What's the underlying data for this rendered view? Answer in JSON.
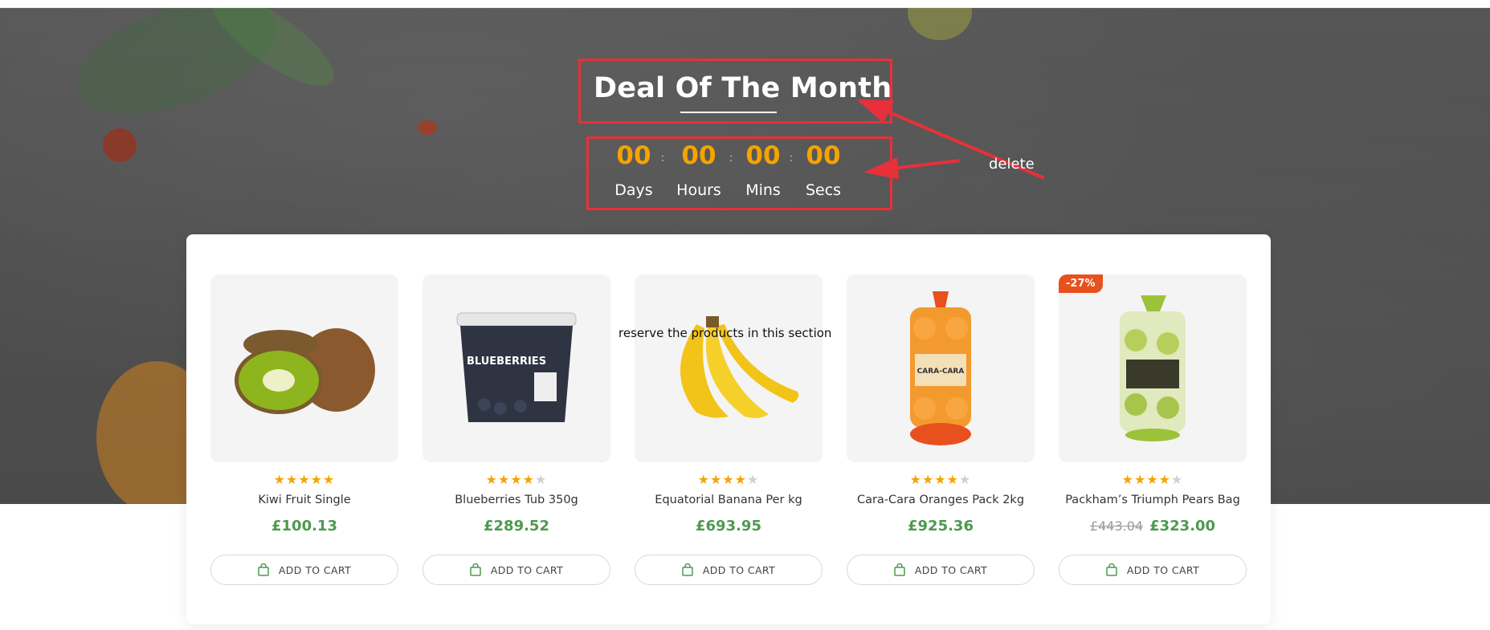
{
  "deal": {
    "title": "Deal Of The Month",
    "countdown": [
      {
        "value": "00",
        "label": "Days"
      },
      {
        "value": "00",
        "label": "Hours"
      },
      {
        "value": "00",
        "label": "Mins"
      },
      {
        "value": "00",
        "label": "Secs"
      }
    ],
    "separator": ":"
  },
  "annotations": {
    "delete_label": "delete",
    "reserve_label": "reserve  the products in this section",
    "color": "#e8303a"
  },
  "products": [
    {
      "name": "Kiwi Fruit Single",
      "price": "£100.13",
      "old_price": "",
      "badge": "",
      "rating": 5,
      "add_to_cart": "ADD TO CART"
    },
    {
      "name": "Blueberries Tub 350g",
      "price": "£289.52",
      "old_price": "",
      "badge": "",
      "rating": 4,
      "add_to_cart": "ADD TO CART"
    },
    {
      "name": "Equatorial Banana Per kg",
      "price": "£693.95",
      "old_price": "",
      "badge": "",
      "rating": 4,
      "add_to_cart": "ADD TO CART"
    },
    {
      "name": "Cara-Cara Oranges Pack 2kg",
      "price": "£925.36",
      "old_price": "",
      "badge": "",
      "rating": 4,
      "add_to_cart": "ADD TO CART"
    },
    {
      "name": "Packham’s Triumph Pears Bag",
      "price": "£323.00",
      "old_price": "£443.04",
      "badge": "-27%",
      "rating": 4,
      "add_to_cart": "ADD TO CART"
    }
  ],
  "product_image_text": {
    "blueberries": "BLUEBERRIES",
    "oranges": "CARA-CARA"
  },
  "colors": {
    "accent_orange": "#f5a300",
    "price_green": "#4d9a4f",
    "badge_red": "#e8501e"
  }
}
